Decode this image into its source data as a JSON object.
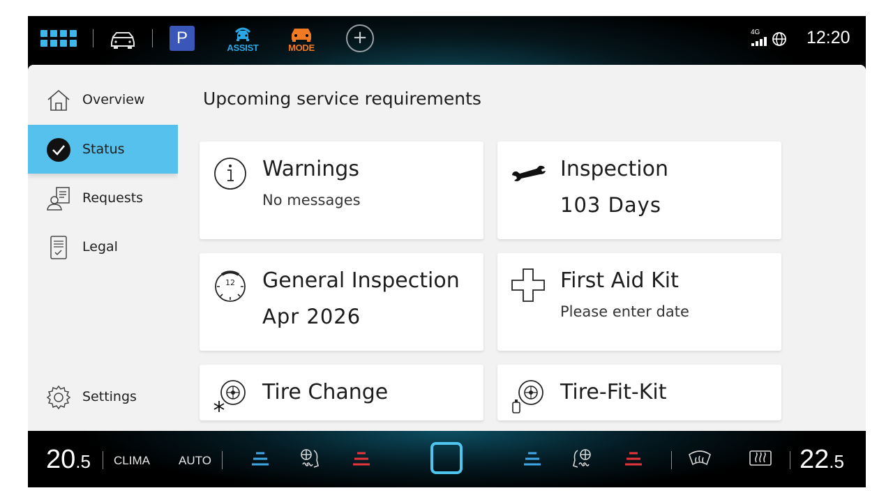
{
  "topbar": {
    "icons": [
      "apps-grid-icon",
      "car-icon",
      "parking-icon",
      "assist-icon",
      "mode-icon",
      "add-icon",
      "signal-icon",
      "globe-icon"
    ],
    "parking_label": "P",
    "assist_label": "ASSIST",
    "mode_label": "MODE",
    "add_label": "+",
    "network_label": "4G",
    "clock": "12:20",
    "colors": {
      "accent": "#3fb6ea",
      "assist": "#2aa8e6",
      "mode": "#f07a23",
      "parking": "#3a56b8"
    }
  },
  "sidebar": {
    "items": [
      {
        "label": "Overview",
        "icon": "home-icon",
        "active": false
      },
      {
        "label": "Status",
        "icon": "check-circle-icon",
        "active": true
      },
      {
        "label": "Requests",
        "icon": "requests-icon",
        "active": false
      },
      {
        "label": "Legal",
        "icon": "document-icon",
        "active": false
      }
    ],
    "settings_label": "Settings",
    "active_color": "#55c1ec"
  },
  "main": {
    "title": "Upcoming service requirements",
    "cards": [
      {
        "title": "Warnings",
        "value": "No messages",
        "icon": "info-icon"
      },
      {
        "title": "Inspection",
        "value": "103 Days",
        "icon": "wrench-icon"
      },
      {
        "title": "General Inspection",
        "value": "Apr 2026",
        "icon": "clock-icon"
      },
      {
        "title": "First Aid Kit",
        "value": "Please enter date",
        "icon": "first-aid-icon"
      },
      {
        "title": "Tire Change",
        "value": "",
        "icon": "winter-tire-icon"
      },
      {
        "title": "Tire-Fit-Kit",
        "value": "",
        "icon": "tire-fit-kit-icon"
      }
    ]
  },
  "climate": {
    "left_temp_int": "20",
    "left_temp_dec": ".5",
    "clima_label": "CLIMA",
    "auto_label": "AUTO",
    "right_temp_int": "22",
    "right_temp_dec": ".5",
    "icons": [
      "fan-level-icon",
      "seat-ventilation-icon",
      "seat-heat-icon",
      "home-icon",
      "rear-defrost-icon",
      "front-defrost-icon"
    ],
    "colors": {
      "cool": "#3fa9e8",
      "heat": "#e8353b",
      "home": "#4fc4ee"
    }
  }
}
